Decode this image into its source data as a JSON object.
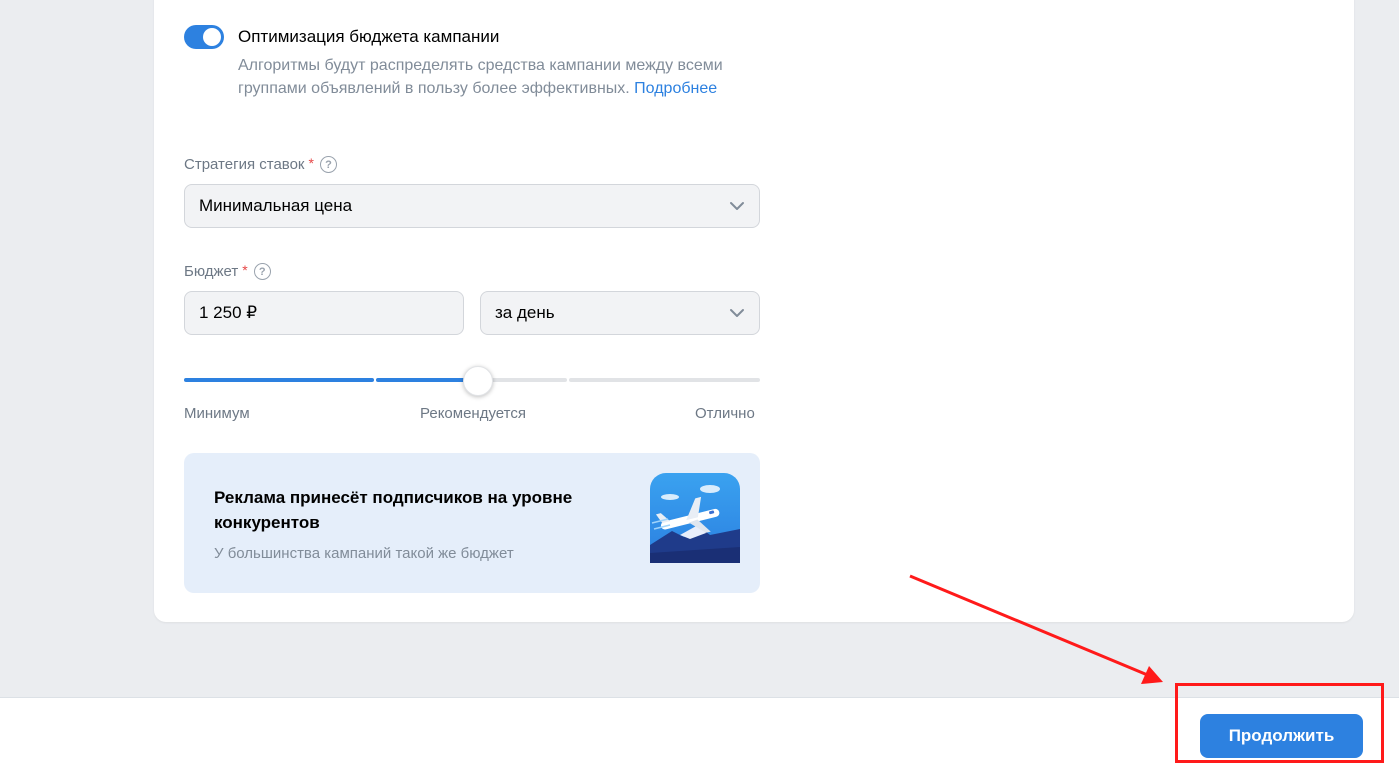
{
  "campaign_budget_optimization": {
    "enabled": true,
    "title": "Оптимизация бюджета кампании",
    "description": "Алгоритмы будут распределять средства кампании между всеми группами объявлений в пользу более эффективных.",
    "more_link": "Подробнее"
  },
  "bid_strategy": {
    "label": "Стратегия ставок",
    "required_mark": "*",
    "help": "?",
    "value": "Минимальная цена"
  },
  "budget": {
    "label": "Бюджет",
    "required_mark": "*",
    "help": "?",
    "amount": "1 250 ₽",
    "period": "за день"
  },
  "budget_slider": {
    "level_fraction": 0.51,
    "labels": {
      "min": "Минимум",
      "recommended": "Рекомендуется",
      "max": "Отлично"
    }
  },
  "promo": {
    "title": "Реклама принесёт подписчиков на уровне конкурентов",
    "subtitle": "У большинства кампаний такой же бюджет",
    "icon": "airplane-illustration"
  },
  "footer": {
    "continue_label": "Продолжить"
  },
  "colors": {
    "accent": "#2d81e0",
    "annotation": "#ff1a1a",
    "track_inactive": "#e1e3e6",
    "promo_bg": "#e5eefa"
  }
}
